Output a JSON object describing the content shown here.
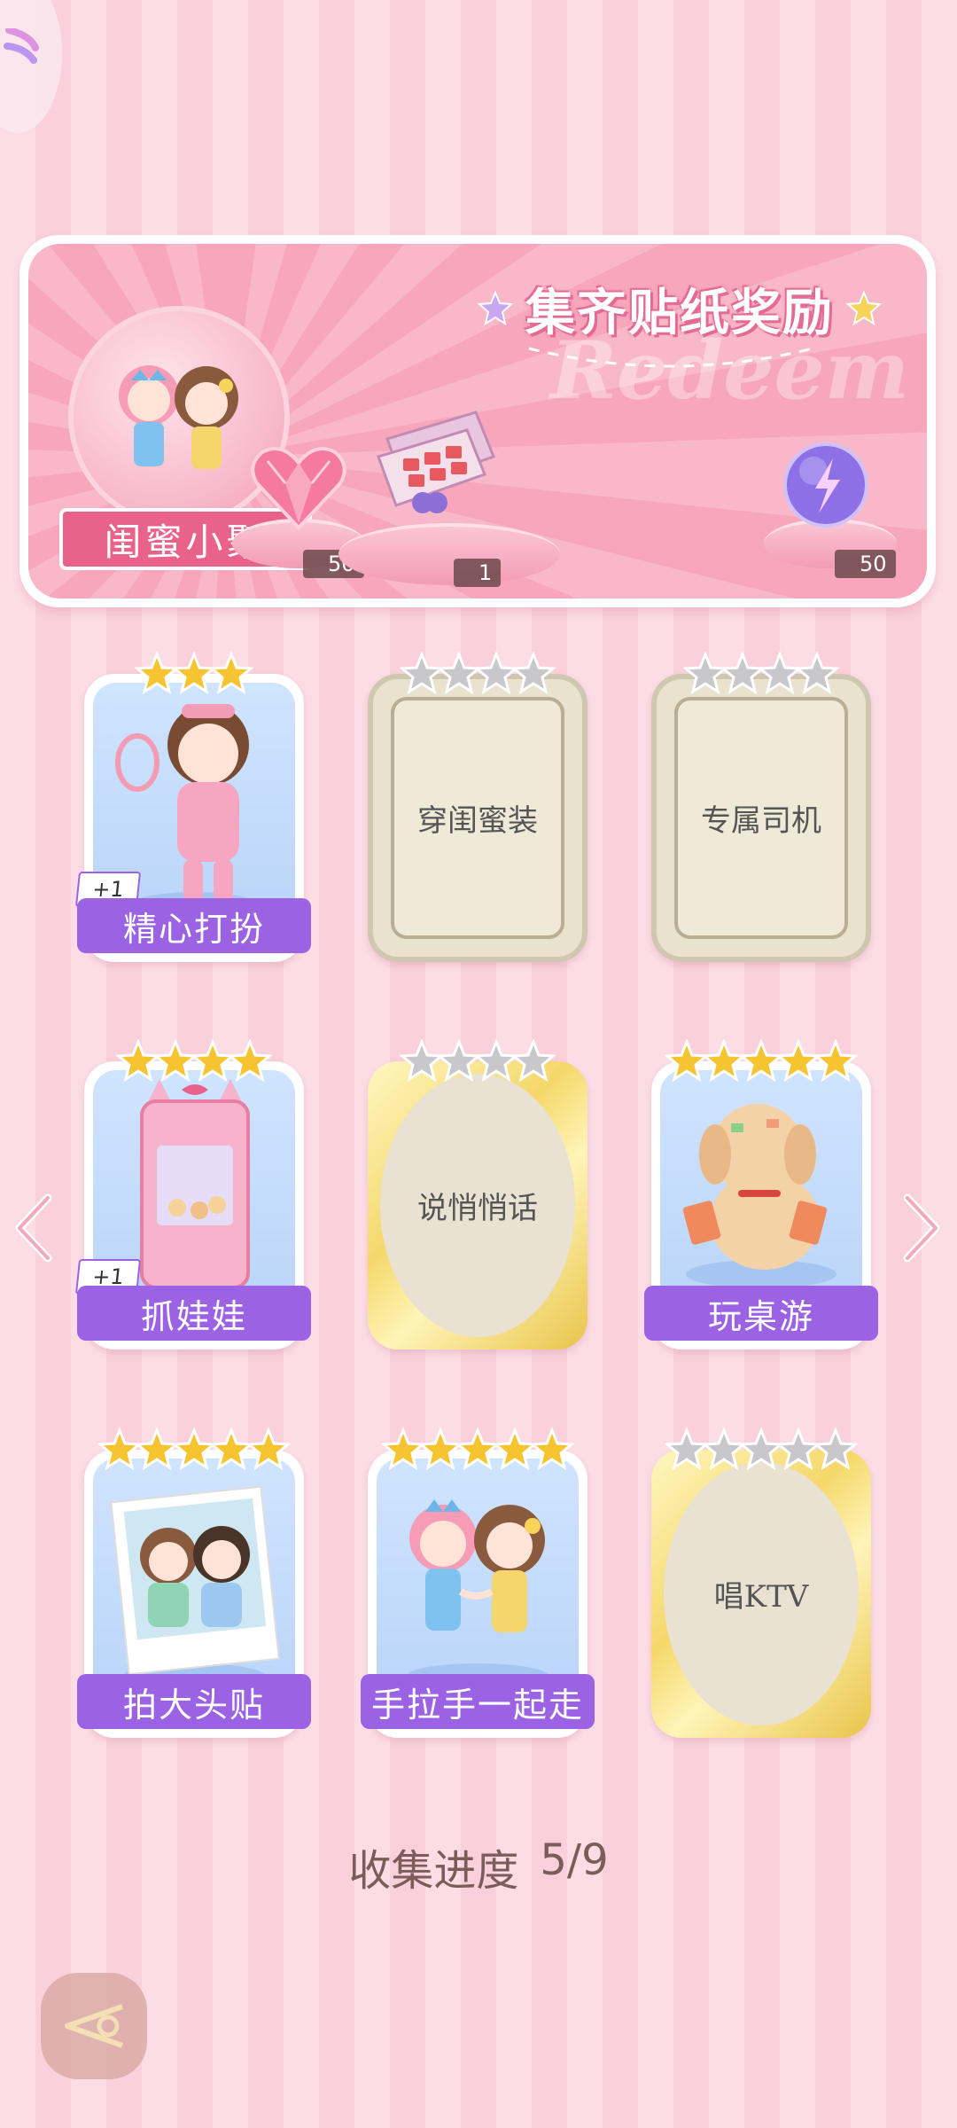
{
  "banner": {
    "title": "集齐贴纸奖励",
    "watermark": "Redeem",
    "theme_label": "闺蜜小聚",
    "rewards": [
      {
        "icon": "heart-gem-icon",
        "quantity": "50"
      },
      {
        "icon": "gift-box-icon",
        "quantity": "1"
      },
      {
        "icon": "energy-orb-icon",
        "quantity": "50"
      }
    ]
  },
  "stickers": [
    {
      "label": "精心打扮",
      "state": "collected",
      "stars": 3,
      "bonus": "+1"
    },
    {
      "label": "穿闺蜜装",
      "state": "locked",
      "stars": 4
    },
    {
      "label": "专属司机",
      "state": "locked",
      "stars": 4
    },
    {
      "label": "抓娃娃",
      "state": "collected",
      "stars": 4,
      "bonus": "+1"
    },
    {
      "label": "说悄悄话",
      "state": "gold-locked",
      "stars": 4
    },
    {
      "label": "玩桌游",
      "state": "collected",
      "stars": 5
    },
    {
      "label": "拍大头贴",
      "state": "collected",
      "stars": 5
    },
    {
      "label": "手拉手一起走",
      "state": "collected",
      "stars": 5
    },
    {
      "label": "唱KTV",
      "state": "gold-locked",
      "stars": 5
    }
  ],
  "progress": {
    "label": "收集进度",
    "value": "5/9"
  },
  "colors": {
    "accent": "#9b63e4",
    "pink": "#e9628a",
    "gold_star": "#f6c431",
    "grey_star": "#c8c8cc"
  }
}
